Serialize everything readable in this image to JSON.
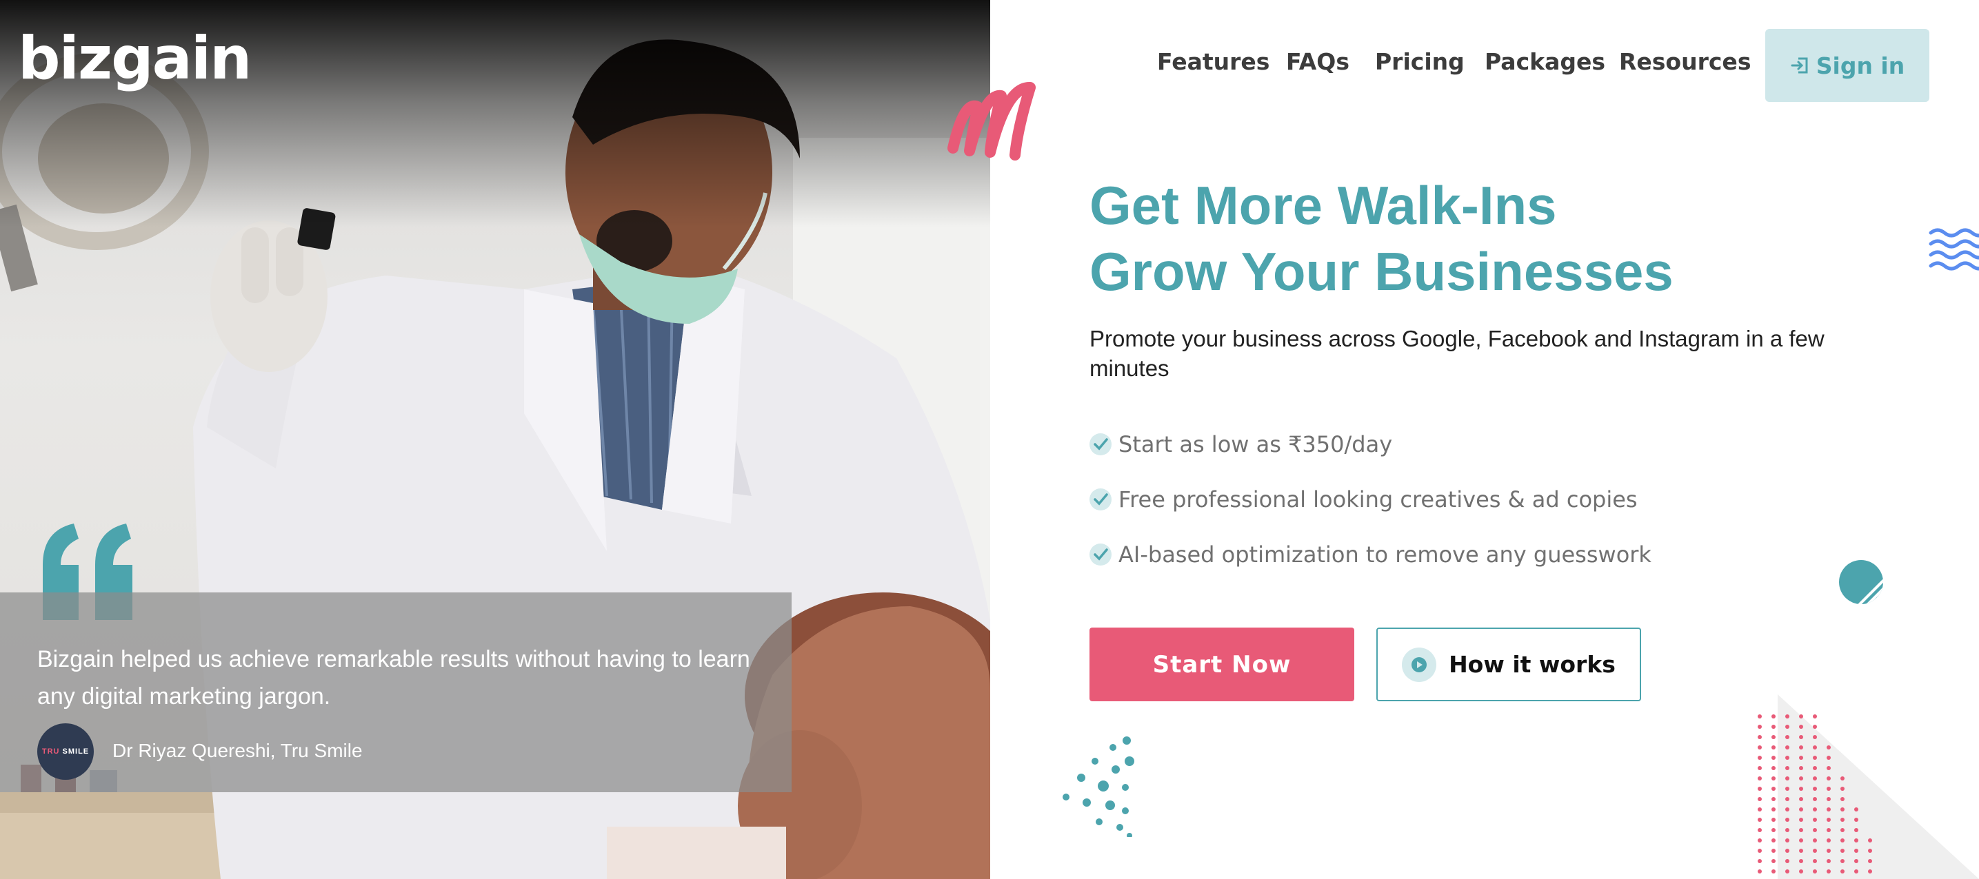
{
  "brand": {
    "logo_text": "bizgain"
  },
  "nav": {
    "items": [
      "Features",
      "FAQs",
      "Pricing",
      "Packages",
      "Resources"
    ],
    "signin_label": "Sign in"
  },
  "hero": {
    "headline_line1": "Get More Walk-Ins",
    "headline_line2": "Grow Your Businesses",
    "subheadline": "Promote your business across Google, Facebook and Instagram in a few minutes",
    "features": [
      "Start as low as ₹350/day",
      "Free professional looking creatives & ad copies",
      "AI-based optimization to remove any guesswork"
    ],
    "cta_primary": "Start Now",
    "cta_secondary": "How it works"
  },
  "testimonial": {
    "quote": "Bizgain helped us achieve remarkable results without having to learn any digital marketing jargon.",
    "author": "Dr Riyaz Quereshi, Tru Smile",
    "avatar_text_1": "TRU",
    "avatar_text_2": "SMILE"
  },
  "colors": {
    "accent_teal": "#4ca4ad",
    "accent_pink": "#e85a77",
    "signin_bg": "#cfe7ea",
    "deco_blue": "#5b8def"
  },
  "icons": [
    "signin-icon",
    "check-icon",
    "play-icon",
    "quote-icon"
  ]
}
